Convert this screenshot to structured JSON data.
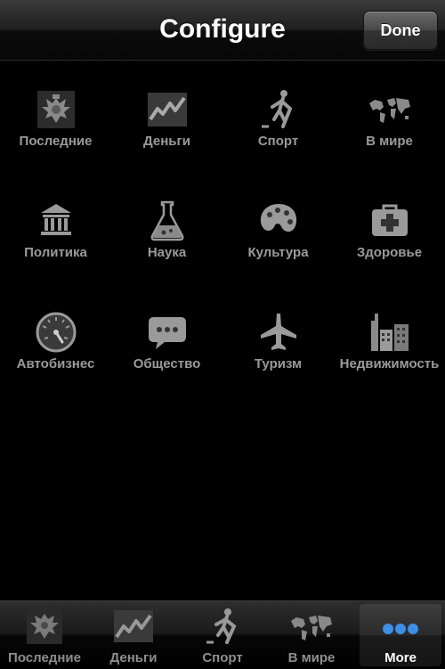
{
  "nav": {
    "title": "Configure",
    "done_label": "Done"
  },
  "categories": [
    {
      "label": "Последние",
      "icon": "russian-eagle-icon"
    },
    {
      "label": "Деньги",
      "icon": "money-chart-icon"
    },
    {
      "label": "Спорт",
      "icon": "hockey-player-icon"
    },
    {
      "label": "В мире",
      "icon": "world-map-icon"
    },
    {
      "label": "Политика",
      "icon": "government-building-icon"
    },
    {
      "label": "Наука",
      "icon": "flask-icon"
    },
    {
      "label": "Культура",
      "icon": "palette-icon"
    },
    {
      "label": "Здоровье",
      "icon": "medical-kit-icon"
    },
    {
      "label": "Автобизнес",
      "icon": "speedometer-icon"
    },
    {
      "label": "Общество",
      "icon": "speech-bubble-icon"
    },
    {
      "label": "Туризм",
      "icon": "airplane-icon"
    },
    {
      "label": "Недвижимость",
      "icon": "buildings-icon"
    }
  ],
  "tabs": [
    {
      "label": "Последние",
      "icon": "russian-eagle-icon"
    },
    {
      "label": "Деньги",
      "icon": "money-chart-icon"
    },
    {
      "label": "Спорт",
      "icon": "hockey-player-icon"
    },
    {
      "label": "В мире",
      "icon": "world-map-icon"
    },
    {
      "label": "More",
      "icon": "more-dots-icon",
      "active": true
    }
  ],
  "colors": {
    "more_dots": "#3d8fe8",
    "label": "#9a9a9a",
    "active_label": "#ffffff"
  }
}
